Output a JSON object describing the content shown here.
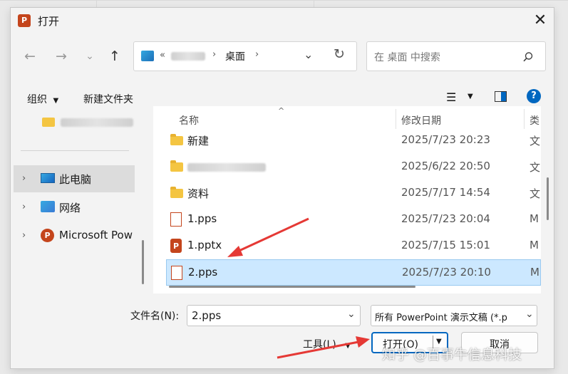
{
  "dialog": {
    "title": "打开"
  },
  "address": {
    "prefix": "«",
    "crumb_current": "桌面"
  },
  "search": {
    "placeholder": "在 桌面 中搜索"
  },
  "toolbar": {
    "organize": "组织",
    "new_folder": "新建文件夹"
  },
  "nav": {
    "items": [
      {
        "label": "此电脑"
      },
      {
        "label": "网络"
      },
      {
        "label": "Microsoft Pow"
      }
    ]
  },
  "columns": {
    "name": "名称",
    "date": "修改日期",
    "type": "类"
  },
  "files": [
    {
      "name": "新建",
      "date": "2025/7/23 20:23",
      "type": "文",
      "kind": "folder"
    },
    {
      "name": "",
      "date": "2025/6/22 20:50",
      "type": "文",
      "kind": "folder"
    },
    {
      "name": "资料",
      "date": "2025/7/17 14:54",
      "type": "文",
      "kind": "folder"
    },
    {
      "name": "1.pps",
      "date": "2025/7/23 20:04",
      "type": "M",
      "kind": "pps"
    },
    {
      "name": "1.pptx",
      "date": "2025/7/15 15:01",
      "type": "M",
      "kind": "pptx"
    },
    {
      "name": "2.pps",
      "date": "2025/7/23 20:10",
      "type": "M",
      "kind": "pps",
      "selected": true
    }
  ],
  "filename": {
    "label": "文件名(N):",
    "value": "2.pps"
  },
  "filetype": {
    "value": "所有 PowerPoint 演示文稿 (*.p"
  },
  "buttons": {
    "tools": "工具(L)",
    "open": "打开(O)",
    "cancel": "取消"
  },
  "watermark": "知乎 @百事牛信息科技",
  "colors": {
    "accent": "#0067c0",
    "selection": "#cce8ff",
    "arrow": "#e53935",
    "ppt": "#c4451c"
  }
}
